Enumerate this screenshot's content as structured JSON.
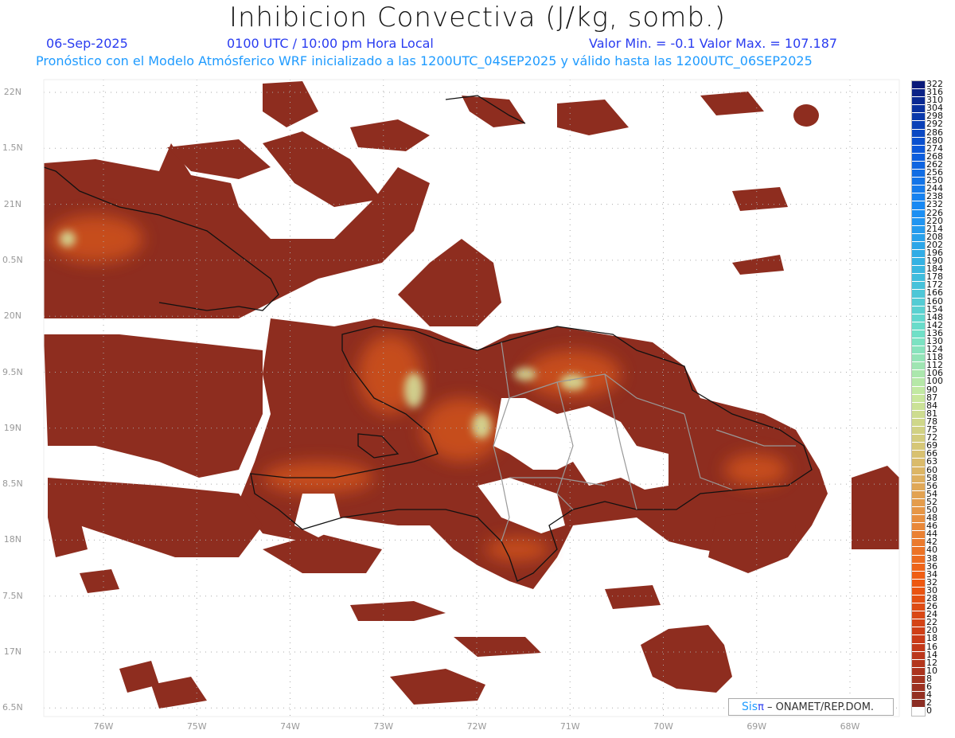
{
  "header": {
    "title": "Inhibicion Convectiva (J/kg, somb.)",
    "date": "06-Sep-2025",
    "time": "0100 UTC / 10:00 pm Hora Local",
    "minmax": "Valor Min. = -0.1  Valor Max. = 107.187",
    "forecast": "Pronóstico con el Modelo Atmósferico WRF inicializado a las 1200UTC_04SEP2025 y válido hasta las  1200UTC_06SEP2025"
  },
  "axes": {
    "lat_labels": [
      "22N",
      "1.5N",
      "21N",
      "0.5N",
      "20N",
      "9.5N",
      "19N",
      "8.5N",
      "18N",
      "7.5N",
      "17N",
      "6.5N"
    ],
    "lat_values": [
      22,
      21.5,
      21,
      20.5,
      20,
      19.5,
      19,
      18.5,
      18,
      17.5,
      17,
      16.5
    ],
    "lon_labels": [
      "76W",
      "75W",
      "74W",
      "73W",
      "72W",
      "71W",
      "70W",
      "69W",
      "68W"
    ],
    "lon_values": [
      -76,
      -75,
      -74,
      -73,
      -72,
      -71,
      -70,
      -69,
      -68
    ]
  },
  "colorbar": {
    "labels": [
      "322",
      "316",
      "310",
      "304",
      "298",
      "292",
      "286",
      "280",
      "274",
      "268",
      "262",
      "256",
      "250",
      "244",
      "238",
      "232",
      "226",
      "220",
      "214",
      "208",
      "202",
      "196",
      "190",
      "184",
      "178",
      "172",
      "166",
      "160",
      "154",
      "148",
      "142",
      "136",
      "130",
      "124",
      "118",
      "112",
      "106",
      "100",
      "90",
      "87",
      "84",
      "81",
      "78",
      "75",
      "72",
      "69",
      "66",
      "63",
      "60",
      "58",
      "56",
      "54",
      "52",
      "50",
      "48",
      "46",
      "44",
      "42",
      "40",
      "38",
      "36",
      "34",
      "32",
      "30",
      "28",
      "26",
      "24",
      "22",
      "20",
      "18",
      "16",
      "14",
      "12",
      "10",
      "8",
      "6",
      "4",
      "2",
      "0"
    ],
    "anchor_colors": [
      "#0a1a7a",
      "#0a55d8",
      "#1a8cf5",
      "#3ab8e0",
      "#6ee0c8",
      "#c8eaa0",
      "#d8c070",
      "#e89040",
      "#f05a10",
      "#c83a18",
      "#8c2e24",
      "#ffffff"
    ]
  },
  "credit": {
    "sis": "Sis",
    "pi": "π",
    "text": "– ONAMET/REP.DOM."
  },
  "colors": {
    "field_low": "#8e2d1f",
    "field_mid": "#c9461c",
    "field_high": "#e8772a",
    "field_peak": "#d6e6a0"
  }
}
